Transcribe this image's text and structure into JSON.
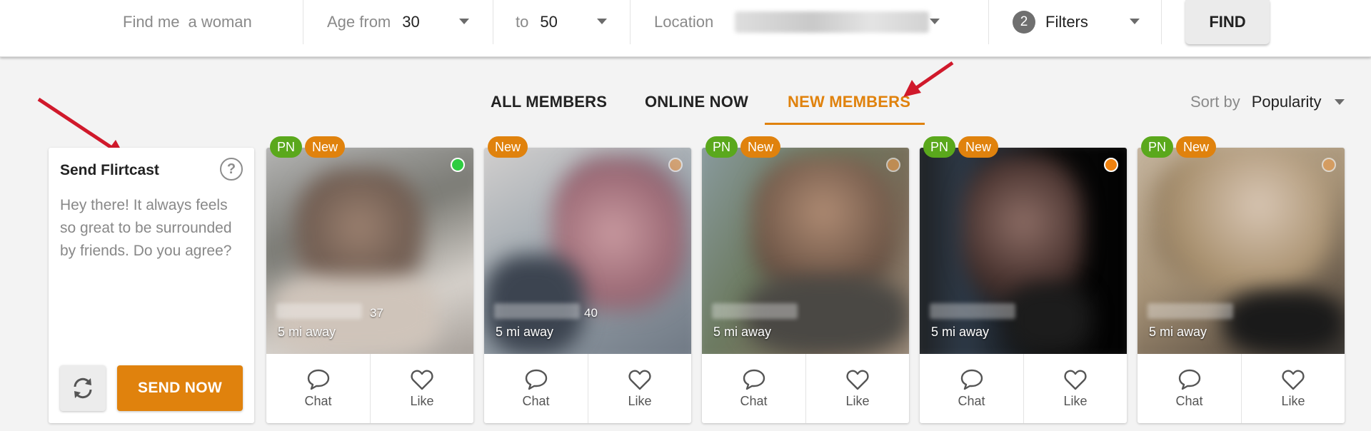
{
  "search": {
    "find_me_label": "Find me",
    "find_me_value": "a woman",
    "age_from_label": "Age from",
    "age_from_value": "30",
    "age_to_label": "to",
    "age_to_value": "50",
    "location_label": "Location",
    "filters_count": "2",
    "filters_label": "Filters",
    "find_button": "FIND"
  },
  "tabs": [
    {
      "label": "ALL MEMBERS",
      "active": false
    },
    {
      "label": "ONLINE NOW",
      "active": false
    },
    {
      "label": "NEW MEMBERS",
      "active": true
    }
  ],
  "sort": {
    "label": "Sort by",
    "value": "Popularity"
  },
  "flirtcast": {
    "title": "Send Flirtcast",
    "help_icon": "?",
    "message": "Hey there! It always feels so great to be surrounded by friends. Do you agree?",
    "send_button": "SEND NOW"
  },
  "colors": {
    "accent": "#e0820d",
    "pn_badge": "#5aa81c",
    "online_green": "#2ecc40",
    "online_orange": "#f0820f"
  },
  "members": [
    {
      "tags": [
        "PN",
        "New"
      ],
      "age": "37",
      "distance": "5 mi away",
      "status": "online"
    },
    {
      "tags": [
        "New"
      ],
      "age": "40",
      "distance": "5 mi away",
      "status": "away"
    },
    {
      "tags": [
        "PN",
        "New"
      ],
      "age": "",
      "distance": "5 mi away",
      "status": "away"
    },
    {
      "tags": [
        "PN",
        "New"
      ],
      "age": "",
      "distance": "5 mi away",
      "status": "away"
    },
    {
      "tags": [
        "PN",
        "New"
      ],
      "age": "",
      "distance": "5 mi away",
      "status": "away"
    }
  ],
  "card_actions": {
    "chat": "Chat",
    "like": "Like"
  }
}
